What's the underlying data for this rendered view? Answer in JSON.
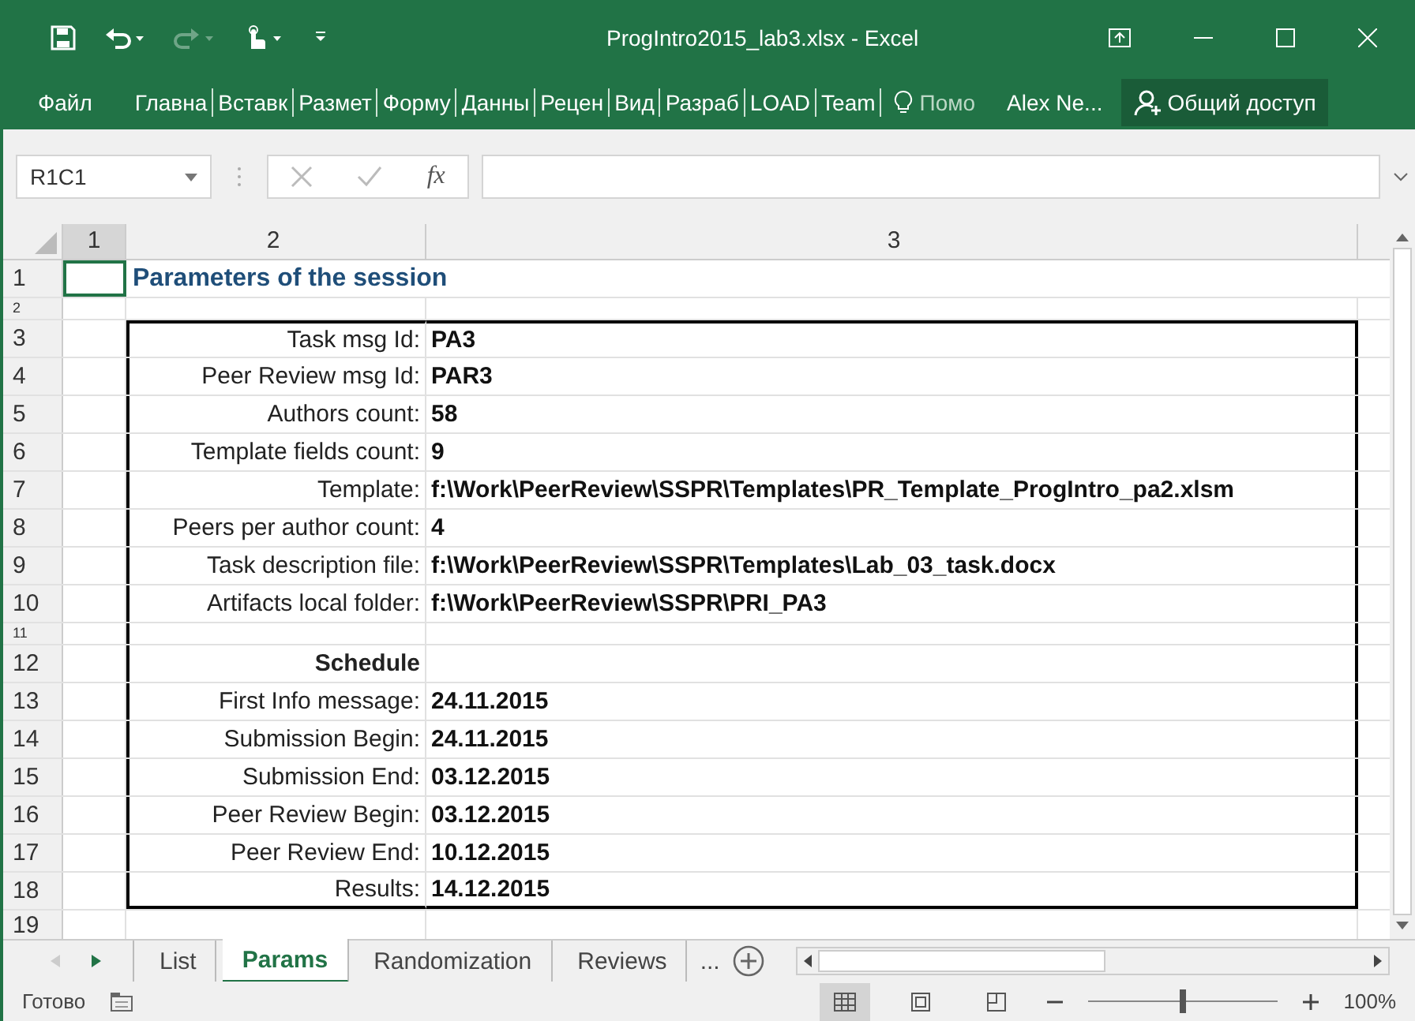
{
  "window": {
    "title": "ProgIntro2015_lab3.xlsx - Excel"
  },
  "ribbon": {
    "tabs": [
      "Файл",
      "Главна",
      "Вставк",
      "Размет",
      "Форму",
      "Данны",
      "Рецен",
      "Вид",
      "Разраб",
      "LOAD",
      "Team"
    ],
    "tell_me": "Помо",
    "user": "Alex Ne...",
    "share": "Общий доступ"
  },
  "formula_bar": {
    "name_box": "R1C1",
    "fx": "fx"
  },
  "columns": [
    "1",
    "2",
    "3"
  ],
  "rows": [
    {
      "number": "1",
      "kind": "title",
      "label": "Parameters of the session"
    },
    {
      "number": "2",
      "kind": "gap"
    },
    {
      "number": "3",
      "kind": "field",
      "label": "Task msg Id:",
      "value": "PA3"
    },
    {
      "number": "4",
      "kind": "field",
      "label": "Peer Review msg Id:",
      "value": "PAR3"
    },
    {
      "number": "5",
      "kind": "field",
      "label": "Authors count:",
      "value": "58"
    },
    {
      "number": "6",
      "kind": "field",
      "label": "Template fields count:",
      "value": "9"
    },
    {
      "number": "7",
      "kind": "field",
      "label": "Template:",
      "value": "f:\\Work\\PeerReview\\SSPR\\Templates\\PR_Template_ProgIntro_pa2.xlsm"
    },
    {
      "number": "8",
      "kind": "field",
      "label": "Peers per author count:",
      "value": "4"
    },
    {
      "number": "9",
      "kind": "field",
      "label": "Task description file:",
      "value": "f:\\Work\\PeerReview\\SSPR\\Templates\\Lab_03_task.docx"
    },
    {
      "number": "10",
      "kind": "field",
      "label": "Artifacts local folder:",
      "value": "f:\\Work\\PeerReview\\SSPR\\PRI_PA3"
    },
    {
      "number": "11",
      "kind": "gap"
    },
    {
      "number": "12",
      "kind": "heading",
      "label": "Schedule"
    },
    {
      "number": "13",
      "kind": "field",
      "label": "First Info message:",
      "value": "24.11.2015"
    },
    {
      "number": "14",
      "kind": "field",
      "label": "Submission Begin:",
      "value": "24.11.2015"
    },
    {
      "number": "15",
      "kind": "field",
      "label": "Submission End:",
      "value": "03.12.2015"
    },
    {
      "number": "16",
      "kind": "field",
      "label": "Peer Review Begin:",
      "value": "03.12.2015"
    },
    {
      "number": "17",
      "kind": "field",
      "label": "Peer Review End:",
      "value": "10.12.2015"
    },
    {
      "number": "18",
      "kind": "field",
      "label": "Results:",
      "value": "14.12.2015"
    },
    {
      "number": "19",
      "kind": "empty"
    }
  ],
  "sheet_tabs": [
    {
      "label": "List",
      "selected": false
    },
    {
      "label": "Params",
      "selected": true
    },
    {
      "label": "Randomization",
      "selected": false
    },
    {
      "label": "Reviews",
      "selected": false
    }
  ],
  "more_tabs": "...",
  "status_bar": {
    "status": "Готово",
    "zoom": "100%",
    "level": 0.5
  }
}
